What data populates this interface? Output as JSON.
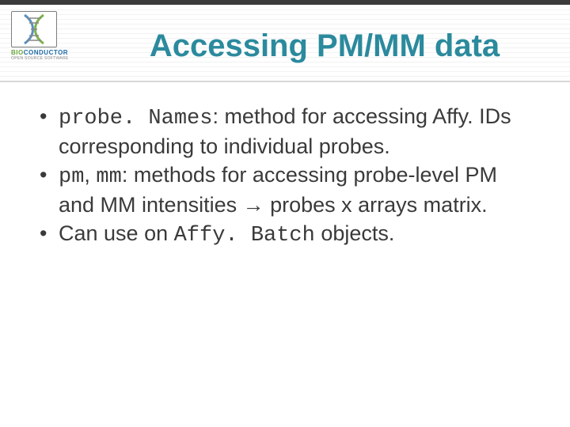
{
  "logo": {
    "name_part1": "BIO",
    "name_part2": "CONDUCTOR",
    "subtitle": "OPEN SOURCE SOFTWARE"
  },
  "title": "Accessing PM/MM data",
  "bullets": {
    "b1": {
      "code": "probe. Names",
      "rest": ": method for accessing Affy. IDs corresponding to individual probes."
    },
    "b2": {
      "code1": "pm",
      "sep": ", ",
      "code2": "mm",
      "rest1": ": methods for accessing probe-level PM and MM intensities ",
      "arrow": "→",
      "rest2": " probes x arrays matrix."
    },
    "b3": {
      "pre": "Can use on ",
      "code": "Affy. Batch",
      "post": " objects."
    }
  }
}
